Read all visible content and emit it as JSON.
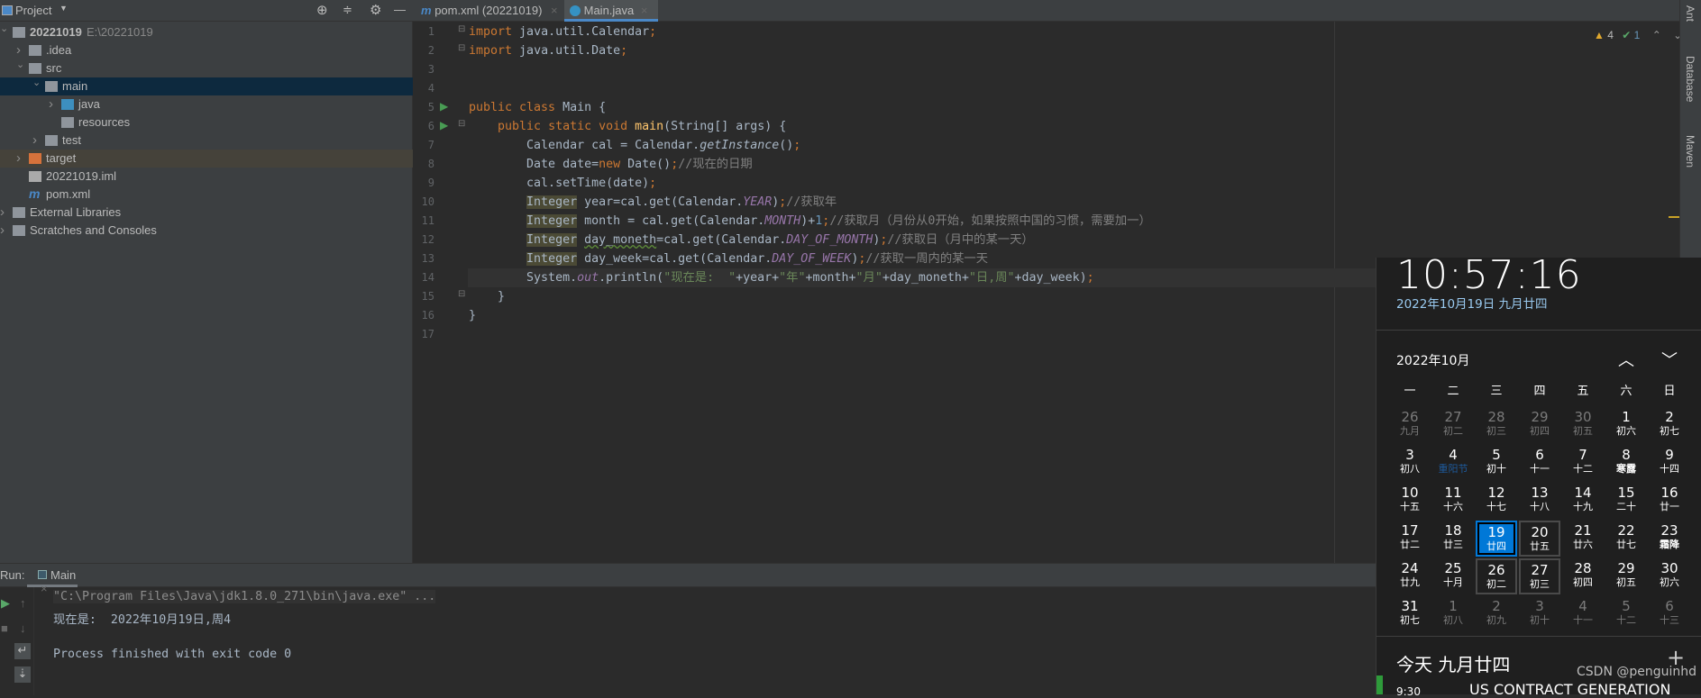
{
  "project": {
    "title": "Project",
    "tree": [
      {
        "label": "20221019",
        "path": "E:\\20221019",
        "icon": "module-folder-icon",
        "depth": 0,
        "arrow": "v"
      },
      {
        "label": ".idea",
        "icon": "folder-icon",
        "depth": 1,
        "arrow": ">"
      },
      {
        "label": "src",
        "icon": "folder-icon",
        "depth": 1,
        "arrow": "v"
      },
      {
        "label": "main",
        "icon": "folder-icon",
        "depth": 2,
        "arrow": "v",
        "selected": true
      },
      {
        "label": "java",
        "icon": "source-folder-icon",
        "depth": 3,
        "arrow": ">"
      },
      {
        "label": "resources",
        "icon": "resources-folder-icon",
        "depth": 3,
        "arrow": ""
      },
      {
        "label": "test",
        "icon": "folder-icon",
        "depth": 2,
        "arrow": ">"
      },
      {
        "label": "target",
        "icon": "excluded-folder-icon",
        "depth": 1,
        "arrow": ">",
        "highlight": true
      },
      {
        "label": "20221019.iml",
        "icon": "iml-file-icon",
        "depth": 1,
        "arrow": ""
      },
      {
        "label": "pom.xml",
        "icon": "maven-icon",
        "depth": 1,
        "arrow": ""
      },
      {
        "label": "External Libraries",
        "icon": "libraries-icon",
        "depth": 0,
        "arrow": ">"
      },
      {
        "label": "Scratches and Consoles",
        "icon": "scratches-icon",
        "depth": 0,
        "arrow": ">"
      }
    ]
  },
  "tabs": [
    {
      "label": "pom.xml (20221019)",
      "icon": "maven-icon",
      "active": false
    },
    {
      "label": "Main.java",
      "icon": "java-class-icon",
      "active": true
    }
  ],
  "inspections": {
    "warnings": "4",
    "typos": "1"
  },
  "right_tools": [
    "Ant",
    "Database",
    "Maven"
  ],
  "code": [
    [
      [
        "kw",
        "import"
      ],
      [
        "t",
        " java.util.Calendar"
      ],
      [
        "kw",
        ";"
      ]
    ],
    [
      [
        "kw",
        "import"
      ],
      [
        "t",
        " java.util.Date"
      ],
      [
        "kw",
        ";"
      ]
    ],
    [],
    [],
    [
      [
        "kw",
        "public class "
      ],
      [
        "t",
        "Main {"
      ]
    ],
    [
      [
        "t",
        "    "
      ],
      [
        "kw",
        "public static void "
      ],
      [
        "fn",
        "main"
      ],
      [
        "t",
        "(String[] args) {"
      ]
    ],
    [
      [
        "t",
        "        Calendar cal = Calendar."
      ],
      [
        "it",
        "getInstance"
      ],
      [
        "t",
        "()"
      ],
      [
        "kw",
        ";"
      ]
    ],
    [
      [
        "t",
        "        Date date="
      ],
      [
        "kw",
        "new"
      ],
      [
        "t",
        " Date()"
      ],
      [
        "kw",
        ";"
      ],
      [
        "cm",
        "//现在的日期"
      ]
    ],
    [
      [
        "t",
        "        cal.setTime(date)"
      ],
      [
        "kw",
        ";"
      ]
    ],
    [
      [
        "t",
        "        "
      ],
      [
        "hl",
        "Integer"
      ],
      [
        "t",
        " year=cal.get(Calendar."
      ],
      [
        "st",
        "YEAR"
      ],
      [
        "t",
        ")"
      ],
      [
        "kw",
        ";"
      ],
      [
        "cm",
        "//获取年"
      ]
    ],
    [
      [
        "t",
        "        "
      ],
      [
        "hl",
        "Integer"
      ],
      [
        "t",
        " month = cal.get(Calendar."
      ],
      [
        "st",
        "MONTH"
      ],
      [
        "t",
        ")+"
      ],
      [
        "num",
        "1"
      ],
      [
        "kw",
        ";"
      ],
      [
        "cm",
        "//获取月（月份从0开始，如果按照中国的习惯，需要加一）"
      ]
    ],
    [
      [
        "t",
        "        "
      ],
      [
        "hl",
        "Integer"
      ],
      [
        "t",
        " "
      ],
      [
        "wv",
        "day_moneth"
      ],
      [
        "t",
        "=cal.get(Calendar."
      ],
      [
        "st",
        "DAY_OF_MONTH"
      ],
      [
        "t",
        ")"
      ],
      [
        "kw",
        ";"
      ],
      [
        "cm",
        "//获取日（月中的某一天）"
      ]
    ],
    [
      [
        "t",
        "        "
      ],
      [
        "hl",
        "Integer"
      ],
      [
        "t",
        " day_week=cal.get(Calendar."
      ],
      [
        "st",
        "DAY_OF_WEEK"
      ],
      [
        "t",
        ")"
      ],
      [
        "kw",
        ";"
      ],
      [
        "cm",
        "//获取一周内的某一天"
      ]
    ],
    [
      [
        "t",
        "        System."
      ],
      [
        "st",
        "out"
      ],
      [
        "t",
        ".println("
      ],
      [
        "str",
        "\"现在是:  \""
      ],
      [
        "t",
        "+year+"
      ],
      [
        "str",
        "\"年\""
      ],
      [
        "t",
        "+month+"
      ],
      [
        "str",
        "\"月\""
      ],
      [
        "t",
        "+day_moneth+"
      ],
      [
        "str",
        "\"日,周\""
      ],
      [
        "t",
        "+day_week)"
      ],
      [
        "kw",
        ";"
      ]
    ],
    [
      [
        "t",
        "    }"
      ]
    ],
    [
      [
        "t",
        "}"
      ]
    ],
    []
  ],
  "current_line": 14,
  "run": {
    "label": "Run:",
    "tab": "Main",
    "output": [
      "\"C:\\Program Files\\Java\\jdk1.8.0_271\\bin\\java.exe\" ...",
      "现在是:  2022年10月19日,周4",
      "",
      "Process finished with exit code 0"
    ]
  },
  "calendar": {
    "time": "10:57:16",
    "date": "2022年10月19日 九月廿四",
    "month": "2022年10月",
    "weekdays": [
      "一",
      "二",
      "三",
      "四",
      "五",
      "六",
      "日"
    ],
    "weeks": [
      [
        [
          "26",
          "九月",
          "o"
        ],
        [
          "27",
          "初二",
          "o"
        ],
        [
          "28",
          "初三",
          "o"
        ],
        [
          "29",
          "初四",
          "o"
        ],
        [
          "30",
          "初五",
          "o"
        ],
        [
          "1",
          "初六",
          ""
        ],
        [
          "2",
          "初七",
          ""
        ]
      ],
      [
        [
          "3",
          "初八",
          ""
        ],
        [
          "4",
          "重阳节",
          "h"
        ],
        [
          "5",
          "初十",
          ""
        ],
        [
          "6",
          "十一",
          ""
        ],
        [
          "7",
          "十二",
          ""
        ],
        [
          "8",
          "寒露",
          "b"
        ],
        [
          "9",
          "十四",
          ""
        ]
      ],
      [
        [
          "10",
          "十五",
          ""
        ],
        [
          "11",
          "十六",
          ""
        ],
        [
          "12",
          "十七",
          ""
        ],
        [
          "13",
          "十八",
          ""
        ],
        [
          "14",
          "十九",
          ""
        ],
        [
          "15",
          "二十",
          ""
        ],
        [
          "16",
          "廿一",
          ""
        ]
      ],
      [
        [
          "17",
          "廿二",
          ""
        ],
        [
          "18",
          "廿三",
          ""
        ],
        [
          "19",
          "廿四",
          "s"
        ],
        [
          "20",
          "廿五",
          "r"
        ],
        [
          "21",
          "廿六",
          ""
        ],
        [
          "22",
          "廿七",
          ""
        ],
        [
          "23",
          "霜降",
          "b"
        ]
      ],
      [
        [
          "24",
          "廿九",
          ""
        ],
        [
          "25",
          "十月",
          ""
        ],
        [
          "26",
          "初二",
          "r"
        ],
        [
          "27",
          "初三",
          "r"
        ],
        [
          "28",
          "初四",
          ""
        ],
        [
          "29",
          "初五",
          ""
        ],
        [
          "30",
          "初六",
          ""
        ]
      ],
      [
        [
          "31",
          "初七",
          ""
        ],
        [
          "1",
          "初八",
          "o"
        ],
        [
          "2",
          "初九",
          "o"
        ],
        [
          "3",
          "初十",
          "o"
        ],
        [
          "4",
          "十一",
          "o"
        ],
        [
          "5",
          "十二",
          "o"
        ],
        [
          "6",
          "十三",
          "o"
        ]
      ]
    ],
    "today": "今天 九月廿四",
    "agenda_time": "9:30",
    "agenda_title": "US CONTRACT GENERATION",
    "accent": "#0078d7"
  },
  "watermark": "CSDN @penguinhd"
}
